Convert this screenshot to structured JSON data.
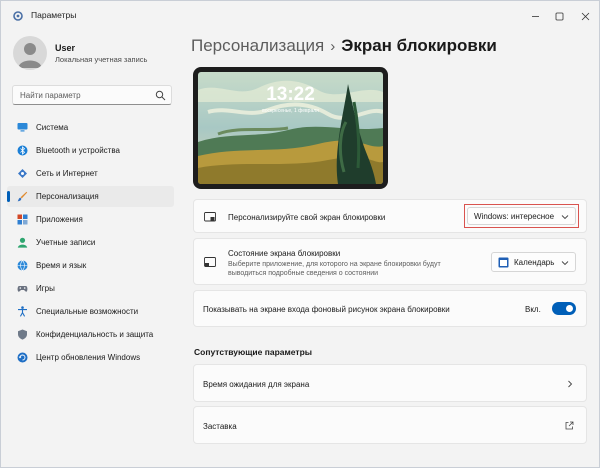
{
  "window": {
    "title": "Параметры"
  },
  "user": {
    "name": "User",
    "account_type": "Локальная учетная запись"
  },
  "search": {
    "placeholder": "Найти параметр"
  },
  "nav": {
    "items": [
      {
        "label": "Система",
        "icon": "monitor-icon",
        "active": false
      },
      {
        "label": "Bluetooth и устройства",
        "icon": "bluetooth-icon",
        "active": false
      },
      {
        "label": "Сеть и Интернет",
        "icon": "network-icon",
        "active": false
      },
      {
        "label": "Персонализация",
        "icon": "brush-icon",
        "active": true
      },
      {
        "label": "Приложения",
        "icon": "apps-icon",
        "active": false
      },
      {
        "label": "Учетные записи",
        "icon": "person-icon",
        "active": false
      },
      {
        "label": "Время и язык",
        "icon": "globe-clock-icon",
        "active": false
      },
      {
        "label": "Игры",
        "icon": "gamepad-icon",
        "active": false
      },
      {
        "label": "Специальные возможности",
        "icon": "accessibility-icon",
        "active": false
      },
      {
        "label": "Конфиденциальность и защита",
        "icon": "shield-icon",
        "active": false
      },
      {
        "label": "Центр обновления Windows",
        "icon": "update-icon",
        "active": false
      }
    ]
  },
  "header": {
    "parent": "Персонализация",
    "separator": "›",
    "current": "Экран блокировки"
  },
  "preview": {
    "time": "13:22",
    "date": "воскресенье, 1 февраля"
  },
  "settings": {
    "personalize": {
      "title": "Персонализируйте свой экран блокировки",
      "value": "Windows: интересное"
    },
    "status": {
      "title": "Состояние экрана блокировки",
      "description": "Выберите приложение, для которого на экране блокировки будут выводиться подробные сведения о состоянии",
      "value": "Календарь"
    },
    "signin_background": {
      "title": "Показывать на экране входа фоновый рисунок экрана блокировки",
      "state_label": "Вкл.",
      "enabled": true
    }
  },
  "related": {
    "title": "Сопутствующие параметры",
    "items": [
      {
        "label": "Время ожидания для экрана"
      },
      {
        "label": "Заставка"
      }
    ]
  },
  "colors": {
    "accent": "#005fb8",
    "highlight_border": "#d9534f"
  }
}
